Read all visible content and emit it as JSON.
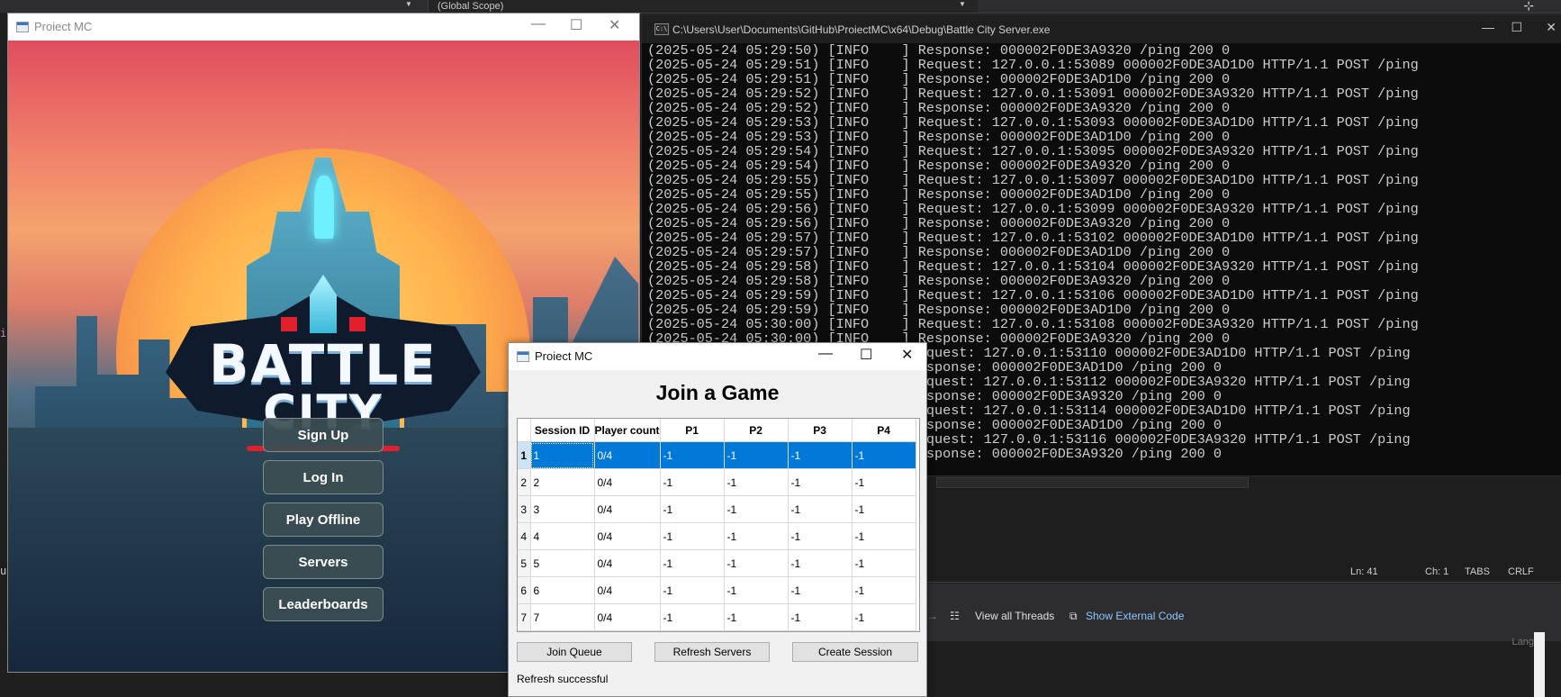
{
  "ide": {
    "scope_label": "(Global Scope)",
    "status": {
      "line": "Ln: 41",
      "col": "Ch: 1",
      "tabs": "TABS",
      "eol": "CRLF"
    },
    "threads_label": "View all Threads",
    "external_code_label": "Show External Code",
    "lang_label": "Lang"
  },
  "console": {
    "title": "C:\\Users\\User\\Documents\\GitHub\\ProiectMC\\x64\\Debug\\Battle City Server.exe",
    "lines": [
      "(2025-05-24 05:29:50) [INFO    ] Response: 000002F0DE3A9320 /ping 200 0",
      "(2025-05-24 05:29:51) [INFO    ] Request: 127.0.0.1:53089 000002F0DE3AD1D0 HTTP/1.1 POST /ping",
      "(2025-05-24 05:29:51) [INFO    ] Response: 000002F0DE3AD1D0 /ping 200 0",
      "(2025-05-24 05:29:52) [INFO    ] Request: 127.0.0.1:53091 000002F0DE3A9320 HTTP/1.1 POST /ping",
      "(2025-05-24 05:29:52) [INFO    ] Response: 000002F0DE3A9320 /ping 200 0",
      "(2025-05-24 05:29:53) [INFO    ] Request: 127.0.0.1:53093 000002F0DE3AD1D0 HTTP/1.1 POST /ping",
      "(2025-05-24 05:29:53) [INFO    ] Response: 000002F0DE3AD1D0 /ping 200 0",
      "(2025-05-24 05:29:54) [INFO    ] Request: 127.0.0.1:53095 000002F0DE3A9320 HTTP/1.1 POST /ping",
      "(2025-05-24 05:29:54) [INFO    ] Response: 000002F0DE3A9320 /ping 200 0",
      "(2025-05-24 05:29:55) [INFO    ] Request: 127.0.0.1:53097 000002F0DE3AD1D0 HTTP/1.1 POST /ping",
      "(2025-05-24 05:29:55) [INFO    ] Response: 000002F0DE3AD1D0 /ping 200 0",
      "(2025-05-24 05:29:56) [INFO    ] Request: 127.0.0.1:53099 000002F0DE3A9320 HTTP/1.1 POST /ping",
      "(2025-05-24 05:29:56) [INFO    ] Response: 000002F0DE3A9320 /ping 200 0",
      "(2025-05-24 05:29:57) [INFO    ] Request: 127.0.0.1:53102 000002F0DE3AD1D0 HTTP/1.1 POST /ping",
      "(2025-05-24 05:29:57) [INFO    ] Response: 000002F0DE3AD1D0 /ping 200 0",
      "(2025-05-24 05:29:58) [INFO    ] Request: 127.0.0.1:53104 000002F0DE3A9320 HTTP/1.1 POST /ping",
      "(2025-05-24 05:29:58) [INFO    ] Response: 000002F0DE3A9320 /ping 200 0",
      "(2025-05-24 05:29:59) [INFO    ] Request: 127.0.0.1:53106 000002F0DE3AD1D0 HTTP/1.1 POST /ping",
      "(2025-05-24 05:29:59) [INFO    ] Response: 000002F0DE3AD1D0 /ping 200 0",
      "(2025-05-24 05:30:00) [INFO    ] Request: 127.0.0.1:53108 000002F0DE3A9320 HTTP/1.1 POST /ping",
      "(2025-05-24 05:30:00) [INFO    ] Response: 000002F0DE3A9320 /ping 200 0",
      "                                Request: 127.0.0.1:53110 000002F0DE3AD1D0 HTTP/1.1 POST /ping",
      "                                Response: 000002F0DE3AD1D0 /ping 200 0",
      "                                Request: 127.0.0.1:53112 000002F0DE3A9320 HTTP/1.1 POST /ping",
      "                                Response: 000002F0DE3A9320 /ping 200 0",
      "                                Request: 127.0.0.1:53114 000002F0DE3AD1D0 HTTP/1.1 POST /ping",
      "                                Response: 000002F0DE3AD1D0 /ping 200 0",
      "                                Request: 127.0.0.1:53116 000002F0DE3A9320 HTTP/1.1 POST /ping",
      "                                Response: 000002F0DE3A9320 /ping 200 0"
    ]
  },
  "main_window": {
    "title": "Proiect MC",
    "logo_line1": "BATTLE",
    "logo_line2": "CITY",
    "buttons": [
      "Sign Up",
      "Log In",
      "Play Offline",
      "Servers",
      "Leaderboards"
    ]
  },
  "join_window": {
    "title": "Proiect MC",
    "heading": "Join a Game",
    "columns": [
      "Session ID",
      "Player count",
      "P1",
      "P2",
      "P3",
      "P4"
    ],
    "rows": [
      [
        "1",
        "1",
        "0/4",
        "-1",
        "-1",
        "-1",
        "-1"
      ],
      [
        "2",
        "2",
        "0/4",
        "-1",
        "-1",
        "-1",
        "-1"
      ],
      [
        "3",
        "3",
        "0/4",
        "-1",
        "-1",
        "-1",
        "-1"
      ],
      [
        "4",
        "4",
        "0/4",
        "-1",
        "-1",
        "-1",
        "-1"
      ],
      [
        "5",
        "5",
        "0/4",
        "-1",
        "-1",
        "-1",
        "-1"
      ],
      [
        "6",
        "6",
        "0/4",
        "-1",
        "-1",
        "-1",
        "-1"
      ],
      [
        "7",
        "7",
        "0/4",
        "-1",
        "-1",
        "-1",
        "-1"
      ]
    ],
    "selected_row": 0,
    "join_queue_label": "Join Queue",
    "refresh_label": "Refresh Servers",
    "create_label": "Create Session",
    "status": "Refresh successful"
  },
  "colors": {
    "selection": "#0078d7",
    "console_bg": "#0c0c0c",
    "ide_bg": "#1e1e1e"
  }
}
